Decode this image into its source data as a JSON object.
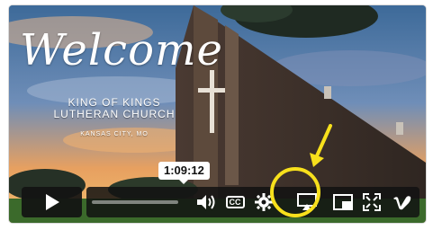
{
  "video": {
    "title": "Welcome",
    "subtitle": "KING OF KINGS\nLUTHERAN CHURCH",
    "location": "KANSAS CITY, MO"
  },
  "controls": {
    "time": "1:09:12",
    "cc_label": "CC",
    "progress_fraction": 0.0,
    "icons": [
      "play-icon",
      "volume-icon",
      "cc-icon",
      "gear-icon",
      "airplay-icon",
      "pip-icon",
      "fullscreen-icon",
      "vimeo-icon"
    ]
  },
  "colors": {
    "highlight": "#f7e01c",
    "panel": "#121212"
  }
}
